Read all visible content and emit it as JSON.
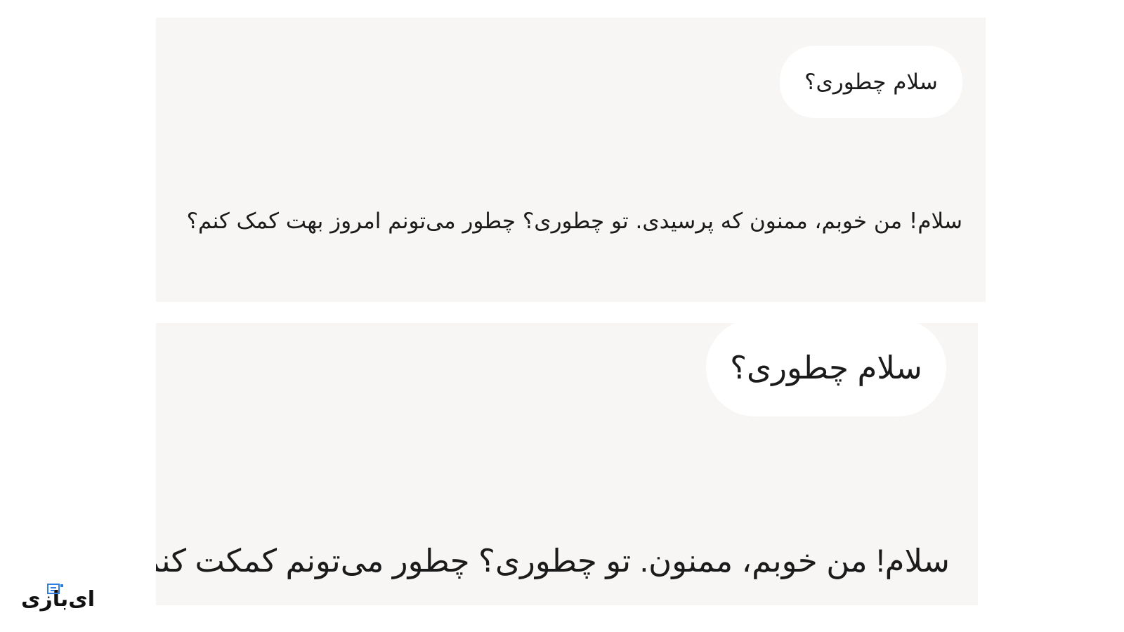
{
  "comparison": {
    "top": {
      "user_message": "سلام چطوری؟",
      "assistant_reply": "سلام! من خوبم، ممنون که پرسیدی. تو چطوری؟ چطور می‌تونم امروز بهت کمک کنم؟"
    },
    "bottom": {
      "user_message": "سلام چطوری؟",
      "assistant_reply": "سلام! من خوبم، ممنون. تو چطوری؟ چطور می‌تونم کمکت کنم؟"
    }
  },
  "watermark": {
    "text": "ای‌بازی",
    "icon": "brand-logo-icon"
  },
  "colors": {
    "panel_background": "#f7f6f5",
    "bubble_background": "#ffffff",
    "text": "#1b1b1b",
    "logo_accent": "#2f7de1"
  }
}
